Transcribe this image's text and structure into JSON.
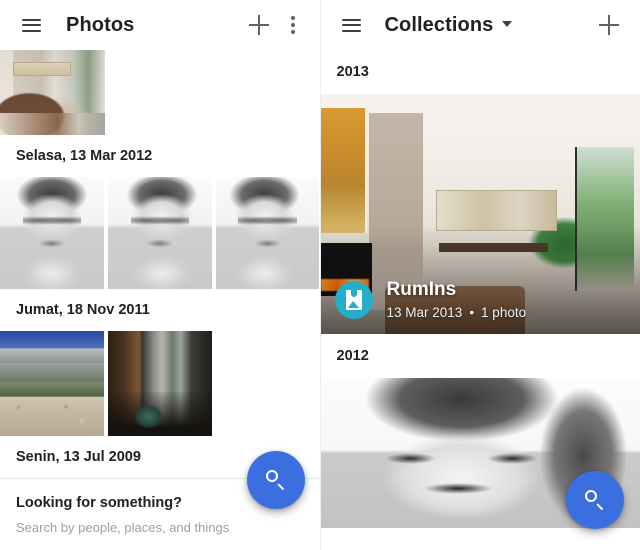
{
  "left_panel": {
    "appbar": {
      "menu_icon": "hamburger-menu-icon",
      "title": "Photos",
      "add_icon": "plus-icon",
      "overflow_icon": "more-vert-icon"
    },
    "sections": [
      {
        "date": "Selasa, 13 Mar 2012",
        "photos": [
          "portrait-bw-1",
          "portrait-bw-2",
          "portrait-bw-3"
        ]
      },
      {
        "date": "Jumat, 18 Nov 2011",
        "photos": [
          "architecture-exterior",
          "architecture-interior-dark"
        ]
      },
      {
        "date": "Senin, 13 Jul 2009",
        "photos": []
      }
    ],
    "suggestion": {
      "title": "Looking for something?",
      "subtitle": "Search by people, places, and things"
    },
    "fab": {
      "icon": "search-icon",
      "color": "#3b6fe0"
    }
  },
  "right_panel": {
    "appbar": {
      "menu_icon": "hamburger-menu-icon",
      "title": "Collections",
      "dropdown_icon": "chevron-down-icon",
      "add_icon": "plus-icon"
    },
    "groups": [
      {
        "year": "2013",
        "album": {
          "name": "RumIns",
          "date": "13 Mar 2013",
          "separator": "•",
          "count": "1 photo",
          "avatar_icon": "album-icon",
          "avatar_color": "#23aec9",
          "cover": "bright-modern-interior"
        }
      },
      {
        "year": "2012",
        "album": {
          "cover": "portrait-bw-closeup"
        }
      }
    ],
    "fab": {
      "icon": "search-icon",
      "color": "#3b6fe0"
    }
  }
}
